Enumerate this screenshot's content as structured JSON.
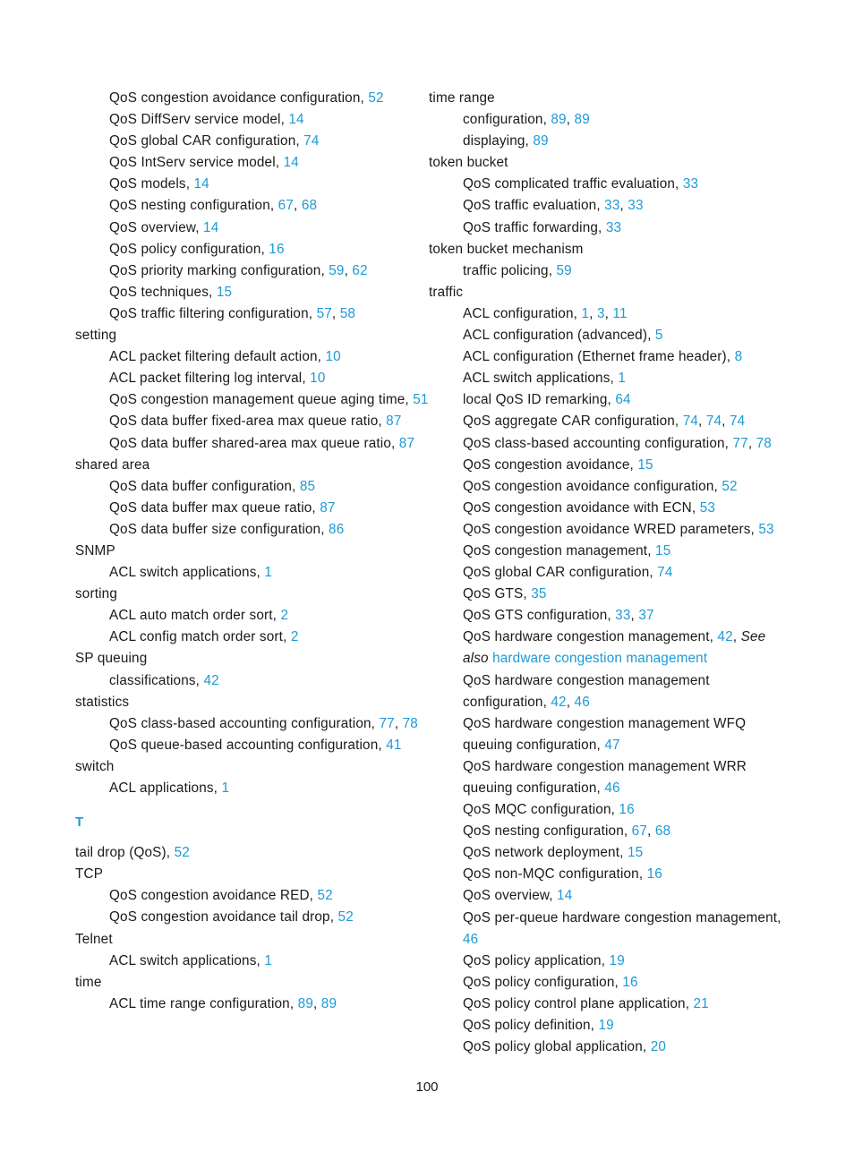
{
  "page": {
    "folio": "100",
    "accent_color": "#1c9ad6",
    "text_color": "#1a1a1a",
    "background_color": "#ffffff"
  },
  "left_column": [
    {
      "level": 2,
      "text": "QoS congestion avoidance configuration,",
      "pages": [
        "52"
      ]
    },
    {
      "level": 2,
      "text": "QoS DiffServ service model,",
      "pages": [
        "14"
      ]
    },
    {
      "level": 2,
      "text": "QoS global CAR configuration,",
      "pages": [
        "74"
      ]
    },
    {
      "level": 2,
      "text": "QoS IntServ service model,",
      "pages": [
        "14"
      ]
    },
    {
      "level": 2,
      "text": "QoS models,",
      "pages": [
        "14"
      ]
    },
    {
      "level": 2,
      "text": "QoS nesting configuration,",
      "pages": [
        "67",
        "68"
      ]
    },
    {
      "level": 2,
      "text": "QoS overview,",
      "pages": [
        "14"
      ]
    },
    {
      "level": 2,
      "text": "QoS policy configuration,",
      "pages": [
        "16"
      ]
    },
    {
      "level": 2,
      "text": "QoS priority marking configuration,",
      "pages": [
        "59",
        "62"
      ]
    },
    {
      "level": 2,
      "text": "QoS techniques,",
      "pages": [
        "15"
      ]
    },
    {
      "level": 2,
      "text": "QoS traffic filtering configuration,",
      "pages": [
        "57",
        "58"
      ]
    },
    {
      "level": 1,
      "text": "setting",
      "pages": []
    },
    {
      "level": 2,
      "text": "ACL packet filtering default action,",
      "pages": [
        "10"
      ]
    },
    {
      "level": 2,
      "text": "ACL packet filtering log interval,",
      "pages": [
        "10"
      ]
    },
    {
      "level": 2,
      "text": "QoS congestion management queue aging time,",
      "pages": [
        "51"
      ]
    },
    {
      "level": 2,
      "text": "QoS data buffer fixed-area max queue ratio,",
      "pages": [
        "87"
      ]
    },
    {
      "level": 2,
      "text": "QoS data buffer shared-area max queue ratio,",
      "pages": [
        "87"
      ]
    },
    {
      "level": 1,
      "text": "shared area",
      "pages": []
    },
    {
      "level": 2,
      "text": "QoS data buffer configuration,",
      "pages": [
        "85"
      ]
    },
    {
      "level": 2,
      "text": "QoS data buffer max queue ratio,",
      "pages": [
        "87"
      ]
    },
    {
      "level": 2,
      "text": "QoS data buffer size configuration,",
      "pages": [
        "86"
      ]
    },
    {
      "level": 1,
      "text": "SNMP",
      "pages": []
    },
    {
      "level": 2,
      "text": "ACL switch applications,",
      "pages": [
        "1"
      ]
    },
    {
      "level": 1,
      "text": "sorting",
      "pages": []
    },
    {
      "level": 2,
      "text": "ACL auto match order sort,",
      "pages": [
        "2"
      ]
    },
    {
      "level": 2,
      "text": "ACL config match order sort,",
      "pages": [
        "2"
      ]
    },
    {
      "level": 1,
      "text": "SP queuing",
      "pages": []
    },
    {
      "level": 2,
      "text": "classifications,",
      "pages": [
        "42"
      ]
    },
    {
      "level": 1,
      "text": "statistics",
      "pages": []
    },
    {
      "level": 2,
      "text": "QoS class-based accounting configuration,",
      "pages": [
        "77",
        "78"
      ]
    },
    {
      "level": 2,
      "text": "QoS queue-based accounting configuration,",
      "pages": [
        "41"
      ]
    },
    {
      "level": 1,
      "text": "switch",
      "pages": []
    },
    {
      "level": 2,
      "text": "ACL applications,",
      "pages": [
        "1"
      ]
    },
    {
      "level": 0,
      "letter": "T"
    },
    {
      "level": 1,
      "text": "tail drop (QoS),",
      "pages": [
        "52"
      ]
    },
    {
      "level": 1,
      "text": "TCP",
      "pages": []
    },
    {
      "level": 2,
      "text": "QoS congestion avoidance RED,",
      "pages": [
        "52"
      ]
    },
    {
      "level": 2,
      "text": "QoS congestion avoidance tail drop,",
      "pages": [
        "52"
      ]
    },
    {
      "level": 1,
      "text": "Telnet",
      "pages": []
    },
    {
      "level": 2,
      "text": "ACL switch applications,",
      "pages": [
        "1"
      ]
    },
    {
      "level": 1,
      "text": "time",
      "pages": []
    },
    {
      "level": 2,
      "text": "ACL time range configuration,",
      "pages": [
        "89",
        "89"
      ]
    }
  ],
  "right_column": [
    {
      "level": 1,
      "text": "time range",
      "pages": []
    },
    {
      "level": 2,
      "text": "configuration,",
      "pages": [
        "89",
        "89"
      ]
    },
    {
      "level": 2,
      "text": "displaying,",
      "pages": [
        "89"
      ]
    },
    {
      "level": 1,
      "text": "token bucket",
      "pages": []
    },
    {
      "level": 2,
      "text": "QoS complicated traffic evaluation,",
      "pages": [
        "33"
      ]
    },
    {
      "level": 2,
      "text": "QoS traffic evaluation,",
      "pages": [
        "33",
        "33"
      ]
    },
    {
      "level": 2,
      "text": "QoS traffic forwarding,",
      "pages": [
        "33"
      ]
    },
    {
      "level": 1,
      "text": "token bucket mechanism",
      "pages": []
    },
    {
      "level": 2,
      "text": "traffic policing,",
      "pages": [
        "59"
      ]
    },
    {
      "level": 1,
      "text": "traffic",
      "pages": []
    },
    {
      "level": 2,
      "text": "ACL configuration,",
      "pages": [
        "1",
        "3",
        "11"
      ]
    },
    {
      "level": 2,
      "text": "ACL configuration (advanced),",
      "pages": [
        "5"
      ]
    },
    {
      "level": 2,
      "text": "ACL configuration (Ethernet frame header),",
      "pages": [
        "8"
      ]
    },
    {
      "level": 2,
      "text": "ACL switch applications,",
      "pages": [
        "1"
      ]
    },
    {
      "level": 2,
      "text": "local QoS ID remarking,",
      "pages": [
        "64"
      ]
    },
    {
      "level": 2,
      "text": "QoS aggregate CAR configuration,",
      "pages": [
        "74",
        "74",
        "74"
      ]
    },
    {
      "level": 2,
      "text": "QoS class-based accounting configuration,",
      "pages": [
        "77",
        "78"
      ]
    },
    {
      "level": 2,
      "text": "QoS congestion avoidance,",
      "pages": [
        "15"
      ]
    },
    {
      "level": 2,
      "text": "QoS congestion avoidance configuration,",
      "pages": [
        "52"
      ]
    },
    {
      "level": 2,
      "text": "QoS congestion avoidance with ECN,",
      "pages": [
        "53"
      ]
    },
    {
      "level": 2,
      "text": "QoS congestion avoidance WRED parameters,",
      "pages": [
        "53"
      ]
    },
    {
      "level": 2,
      "text": "QoS congestion management,",
      "pages": [
        "15"
      ]
    },
    {
      "level": 2,
      "text": "QoS global CAR configuration,",
      "pages": [
        "74"
      ]
    },
    {
      "level": 2,
      "text": "QoS GTS,",
      "pages": [
        "35"
      ]
    },
    {
      "level": 2,
      "text": "QoS GTS configuration,",
      "pages": [
        "33",
        "37"
      ]
    },
    {
      "level": 2,
      "text": "QoS hardware congestion management,",
      "pages": [
        "42"
      ],
      "see_also_label": "See also",
      "see_also_target": "hardware congestion management"
    },
    {
      "level": 2,
      "text": "QoS hardware congestion management configuration,",
      "pages": [
        "42",
        "46"
      ]
    },
    {
      "level": 2,
      "text": "QoS hardware congestion management WFQ queuing configuration,",
      "pages": [
        "47"
      ]
    },
    {
      "level": 2,
      "text": "QoS hardware congestion management WRR queuing configuration,",
      "pages": [
        "46"
      ]
    },
    {
      "level": 2,
      "text": "QoS MQC configuration,",
      "pages": [
        "16"
      ]
    },
    {
      "level": 2,
      "text": "QoS nesting configuration,",
      "pages": [
        "67",
        "68"
      ]
    },
    {
      "level": 2,
      "text": "QoS network deployment,",
      "pages": [
        "15"
      ]
    },
    {
      "level": 2,
      "text": "QoS non-MQC configuration,",
      "pages": [
        "16"
      ]
    },
    {
      "level": 2,
      "text": "QoS overview,",
      "pages": [
        "14"
      ]
    },
    {
      "level": 2,
      "text": "QoS per-queue hardware congestion management,",
      "pages": [
        "46"
      ]
    },
    {
      "level": 2,
      "text": "QoS policy application,",
      "pages": [
        "19"
      ]
    },
    {
      "level": 2,
      "text": "QoS policy configuration,",
      "pages": [
        "16"
      ]
    },
    {
      "level": 2,
      "text": "QoS policy control plane application,",
      "pages": [
        "21"
      ]
    },
    {
      "level": 2,
      "text": "QoS policy definition,",
      "pages": [
        "19"
      ]
    },
    {
      "level": 2,
      "text": "QoS policy global application,",
      "pages": [
        "20"
      ]
    }
  ]
}
